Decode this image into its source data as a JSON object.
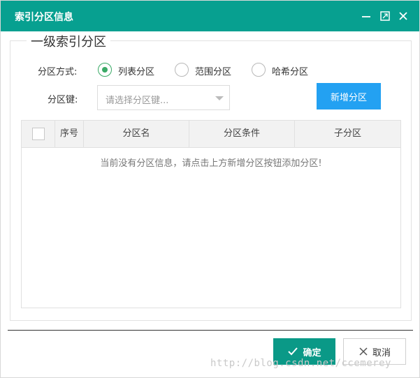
{
  "dialog": {
    "title": "索引分区信息",
    "accent_color": "#07a090",
    "controls": [
      "minimize-icon",
      "maximize-icon",
      "close-icon"
    ]
  },
  "form": {
    "legend": "一级索引分区",
    "partition_type_label": "分区方式:",
    "partition_types": [
      {
        "label": "列表分区",
        "checked": true
      },
      {
        "label": "范围分区",
        "checked": false
      },
      {
        "label": "哈希分区",
        "checked": false
      }
    ],
    "partition_key_label": "分区键:",
    "partition_key_placeholder": "请选择分区键...",
    "add_button": "新增分区",
    "add_button_color": "#23a1f2"
  },
  "table": {
    "columns": [
      "序号",
      "分区名",
      "分区条件",
      "子分区"
    ],
    "empty_message": "当前没有分区信息，请点击上方新增分区按钮添加分区!"
  },
  "footer": {
    "ok_label": "确定",
    "cancel_label": "取消",
    "ok_color": "#0a9987"
  },
  "watermark": "http://blog.csdn.net/ccemerey"
}
